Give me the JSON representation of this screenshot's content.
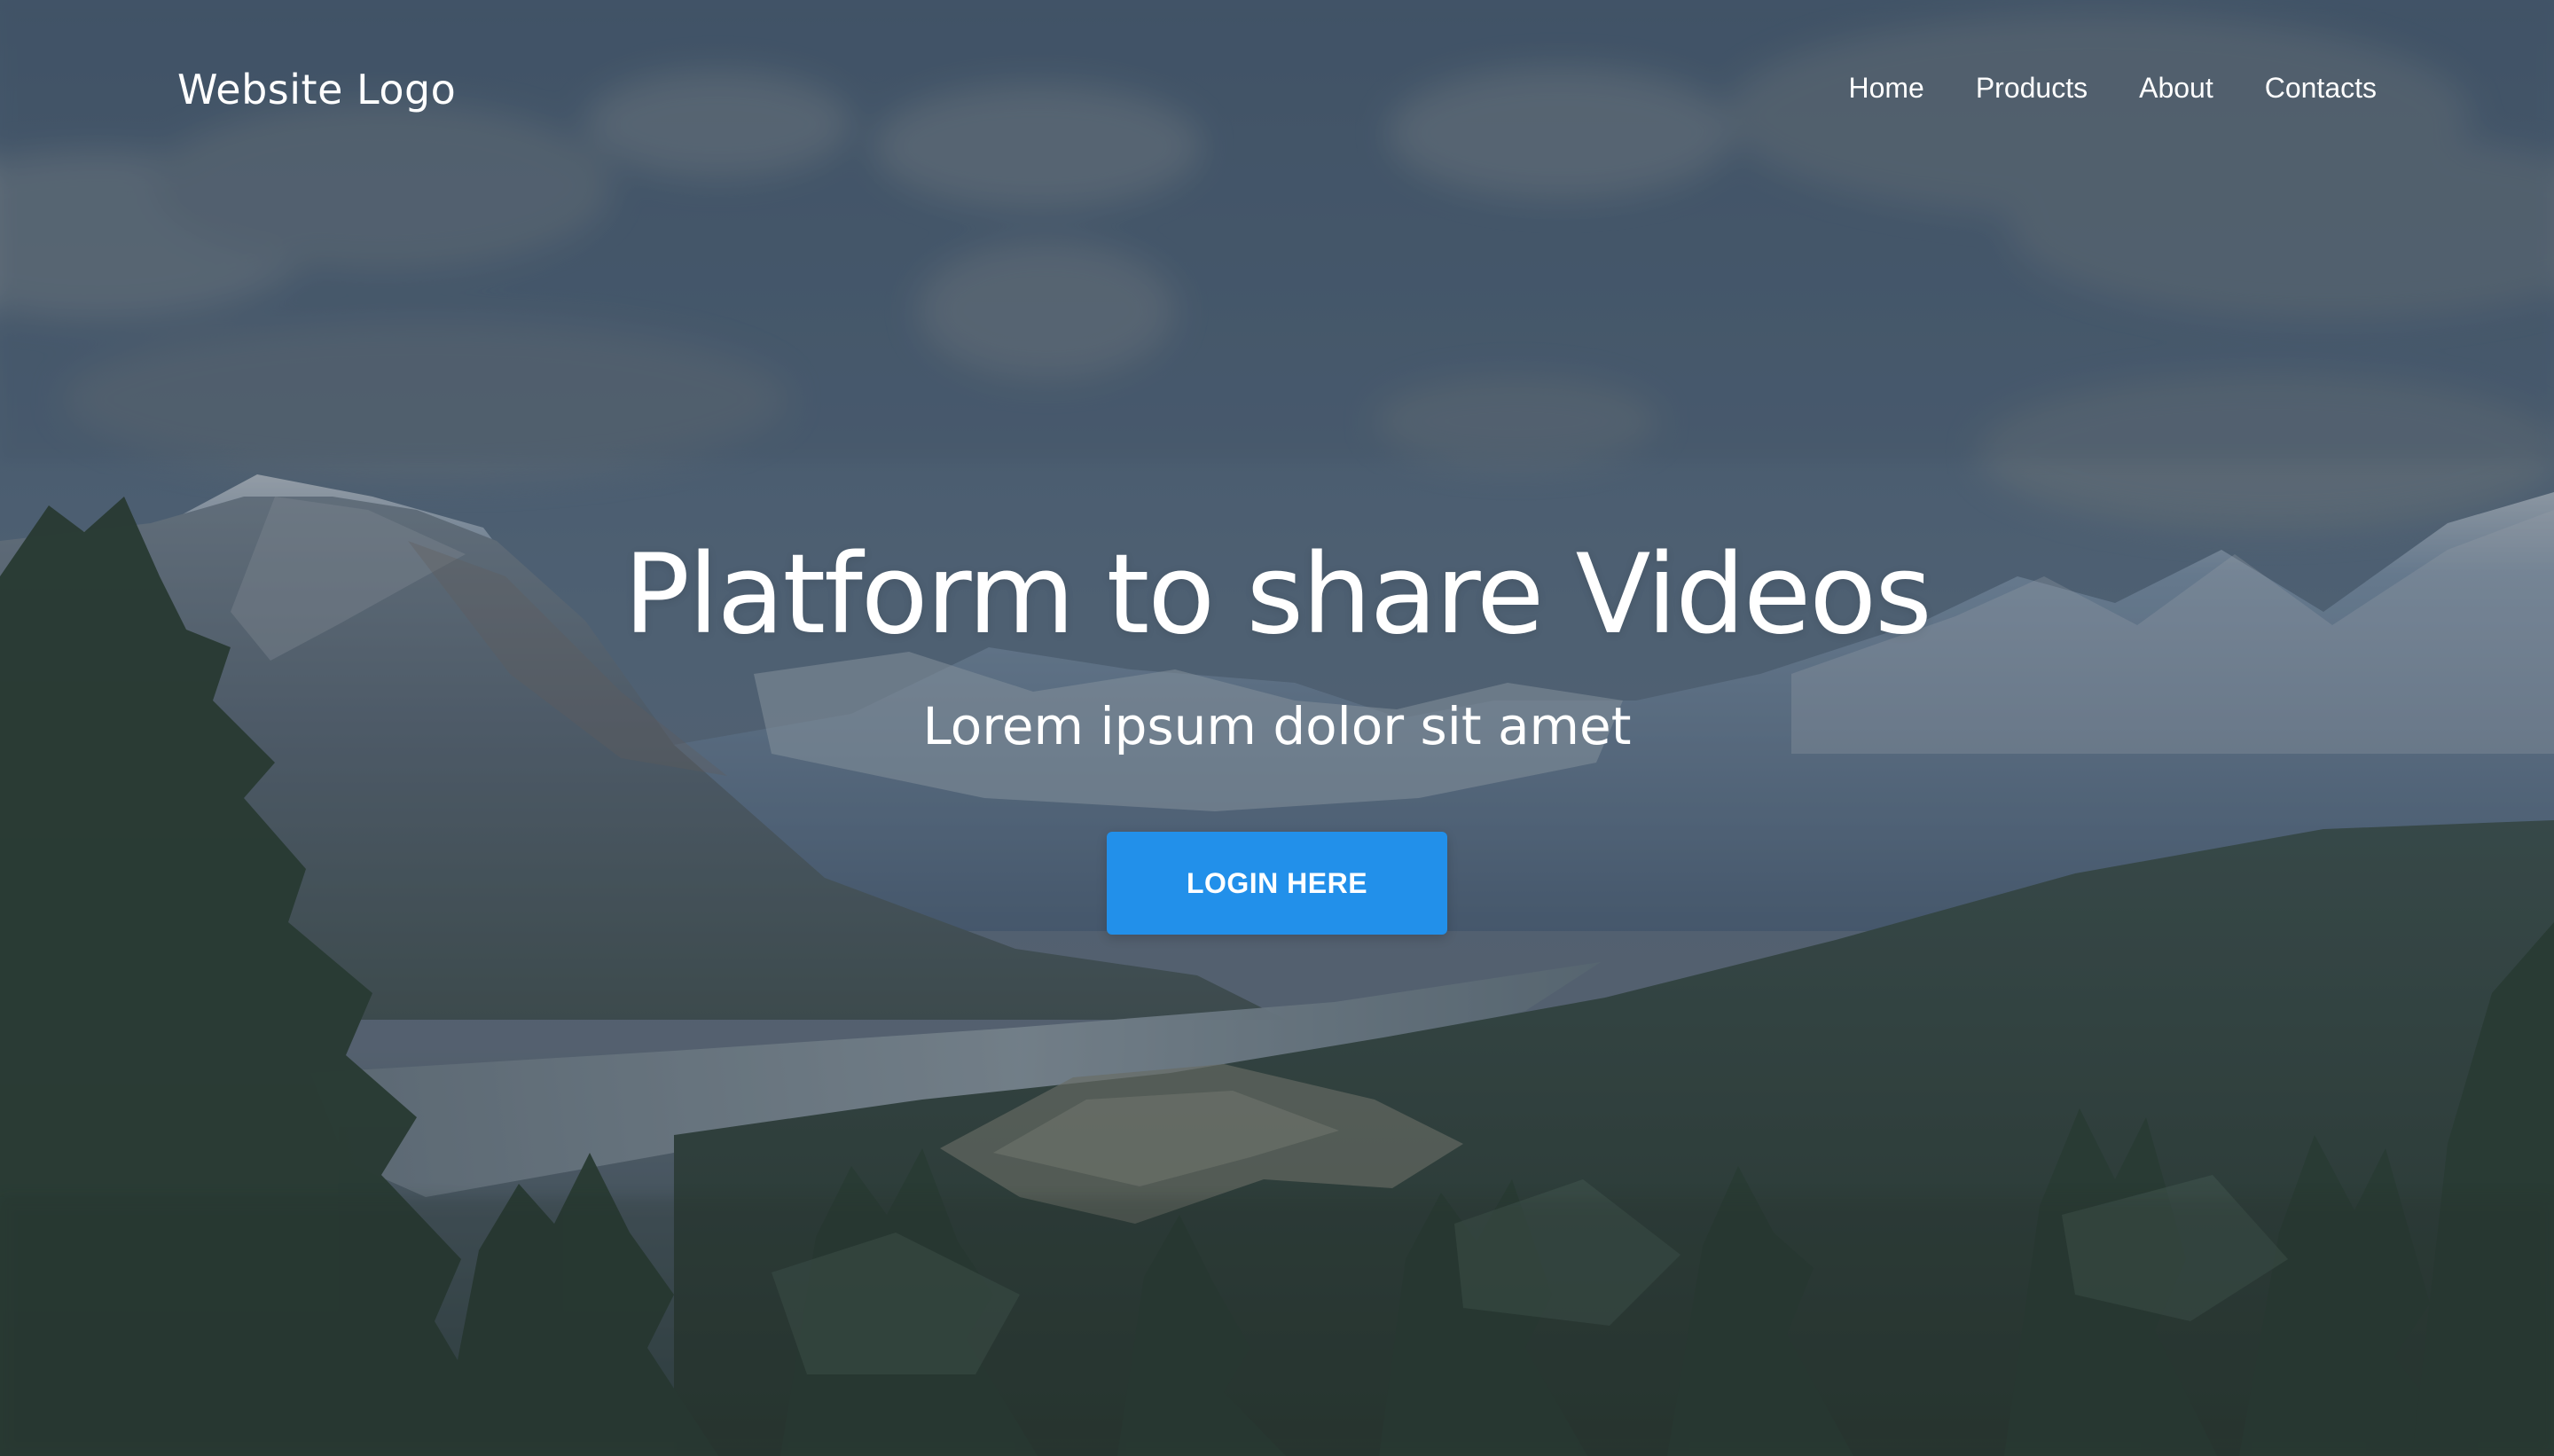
{
  "page": {
    "colors": {
      "overlay": "#2f3c4a",
      "button": "#2290ea",
      "text": "#ffffff"
    }
  },
  "header": {
    "logo": "Website Logo",
    "nav": [
      {
        "label": "Home"
      },
      {
        "label": "Products"
      },
      {
        "label": "About"
      },
      {
        "label": "Contacts"
      }
    ]
  },
  "hero": {
    "title": "Platform to share Videos",
    "subtitle": "Lorem ipsum dolor sit amet",
    "button": "LOGIN HERE"
  }
}
